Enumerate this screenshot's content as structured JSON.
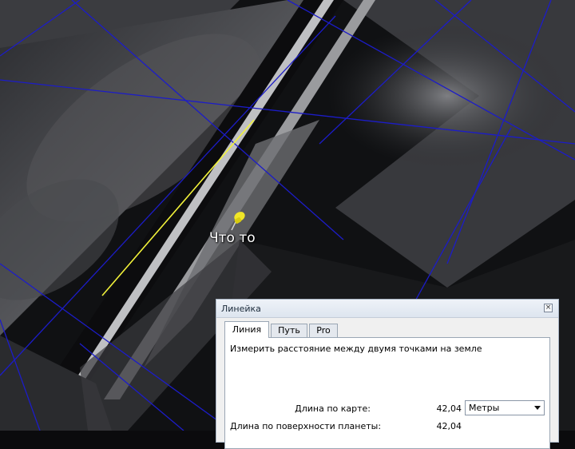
{
  "map": {
    "placemark_label": "Что то"
  },
  "ruler": {
    "title": "Линейка",
    "tabs": [
      {
        "label": "Линия",
        "active": true
      },
      {
        "label": "Путь",
        "active": false
      },
      {
        "label": "Pro",
        "active": false
      }
    ],
    "description": "Измерить расстояние между двумя точками на земле",
    "map_length_label": "Длина по карте:",
    "map_length_value": "42,04",
    "unit_selected": "Метры",
    "surface_length_label": "Длина по поверхности планеты:",
    "surface_length_value": "42,04"
  },
  "colors": {
    "grid": "#1c1cc8",
    "ruler_line": "#f2f23a",
    "pin": "#e8e020"
  }
}
